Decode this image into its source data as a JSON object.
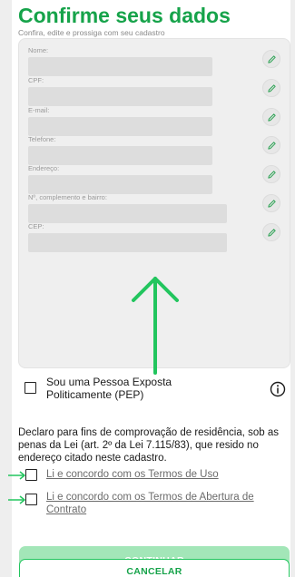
{
  "header": {
    "title": "Confirme seus dados",
    "subtitle": "Confira, edite e prossiga com seu cadastro"
  },
  "form": {
    "fields": [
      {
        "label": "Nome:"
      },
      {
        "label": "CPF:"
      },
      {
        "label": "E-mail:"
      },
      {
        "label": "Telefone:"
      },
      {
        "label": "Endereço:"
      },
      {
        "label": "Nº, complemento e bairro:"
      },
      {
        "label": "CEP:"
      }
    ]
  },
  "pep": {
    "label": "Sou uma Pessoa Exposta Politicamente (PEP)"
  },
  "declaration": "Declaro para fins de comprovação de residência, sob as penas da Lei (art. 2º da Lei 7.115/83), que resido no endereço citado neste cadastro.",
  "terms": {
    "use": "Li e concordo com os Termos de Uso",
    "account": "Li e concordo com os Termos de Abertura de Contrato"
  },
  "buttons": {
    "continue": "CONTINUAR",
    "cancel": "CANCELAR"
  },
  "colors": {
    "brand_green": "#16a34a",
    "annotation_green": "#22c55e",
    "continue_disabled": "#a3e6b8"
  }
}
